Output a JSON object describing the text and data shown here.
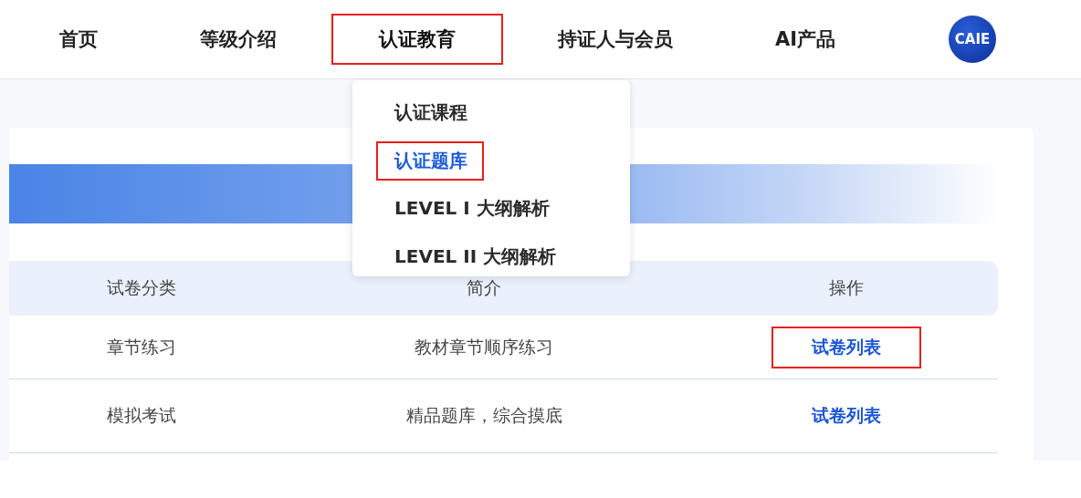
{
  "nav": {
    "items": [
      {
        "label": "首页",
        "expanded": false,
        "highlighted": false
      },
      {
        "label": "等级介绍",
        "expanded": false,
        "highlighted": false
      },
      {
        "label": "认证教育",
        "expanded": true,
        "highlighted": true
      },
      {
        "label": "持证人与会员",
        "expanded": false,
        "highlighted": false
      },
      {
        "label": "AI产品",
        "expanded": false,
        "highlighted": false
      }
    ],
    "logo": "CAIE"
  },
  "dropdown": {
    "items": [
      {
        "label": "认证课程",
        "selected": false,
        "highlighted": false
      },
      {
        "label": "认证题库",
        "selected": true,
        "highlighted": true
      },
      {
        "label": "LEVEL I 大纲解析",
        "selected": false,
        "highlighted": false
      },
      {
        "label": "LEVEL II 大纲解析",
        "selected": false,
        "highlighted": false
      }
    ]
  },
  "table": {
    "columns": [
      "试卷分类",
      "简介",
      "操作"
    ],
    "rows": [
      {
        "category": "章节练习",
        "intro": "教材章节顺序练习",
        "action": {
          "label": "试卷列表",
          "highlighted": true
        }
      },
      {
        "category": "模拟考试",
        "intro": "精品题库，综合摸底",
        "action": {
          "label": "试卷列表",
          "highlighted": false
        }
      }
    ]
  }
}
